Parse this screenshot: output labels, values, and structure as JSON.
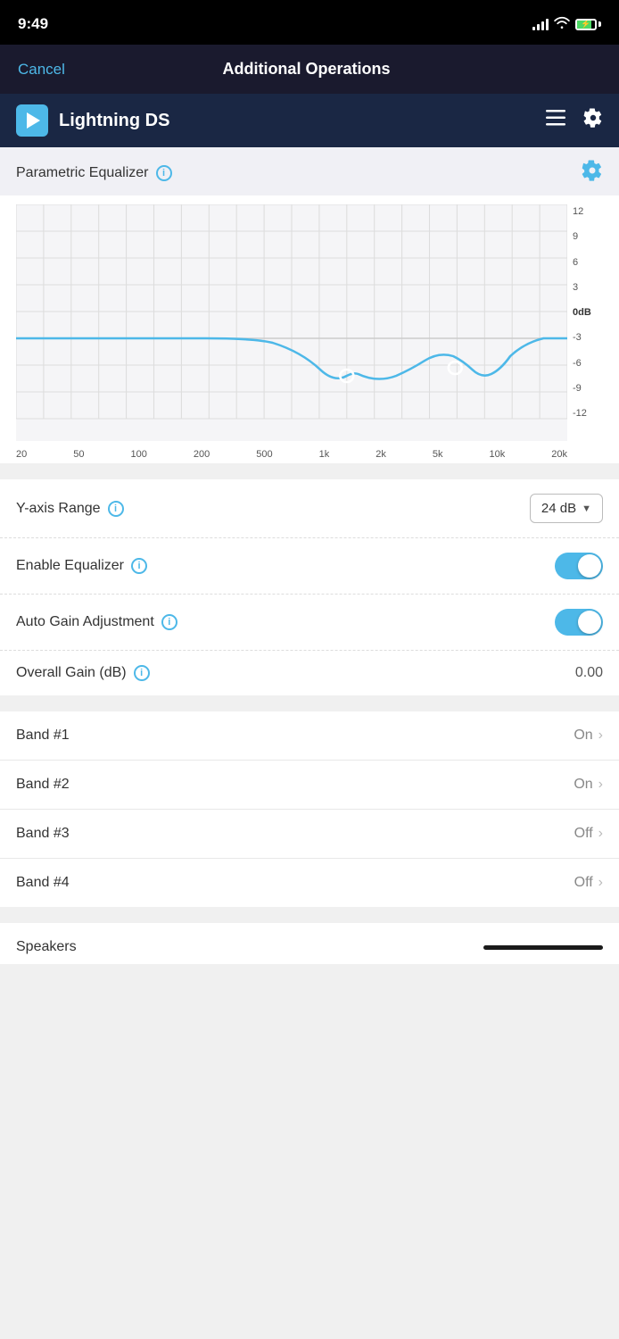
{
  "statusBar": {
    "time": "9:49"
  },
  "navBar": {
    "cancelLabel": "Cancel",
    "title": "Additional Operations"
  },
  "appHeader": {
    "appName": "Lightning DS",
    "menuIconLabel": "menu",
    "settingsIconLabel": "settings"
  },
  "parametricEqualizer": {
    "title": "Parametric Equalizer",
    "gearIconLabel": "settings"
  },
  "equalizerChart": {
    "yAxisLabels": [
      "12",
      "9",
      "6",
      "3",
      "0dB",
      "-3",
      "-6",
      "-9",
      "-12"
    ],
    "xAxisLabels": [
      "20",
      "50",
      "100",
      "200",
      "500",
      "1k",
      "2k",
      "5k",
      "10k",
      "20k"
    ]
  },
  "settings": {
    "yAxisRange": {
      "label": "Y-axis Range",
      "value": "24 dB"
    },
    "enableEqualizer": {
      "label": "Enable Equalizer",
      "enabled": true
    },
    "autoGainAdjustment": {
      "label": "Auto Gain Adjustment",
      "enabled": true
    },
    "overallGain": {
      "label": "Overall Gain (dB)",
      "value": "0.00"
    }
  },
  "bands": [
    {
      "label": "Band #1",
      "status": "On"
    },
    {
      "label": "Band #2",
      "status": "On"
    },
    {
      "label": "Band #3",
      "status": "Off"
    },
    {
      "label": "Band #4",
      "status": "Off"
    }
  ],
  "speakers": {
    "label": "Speakers"
  }
}
